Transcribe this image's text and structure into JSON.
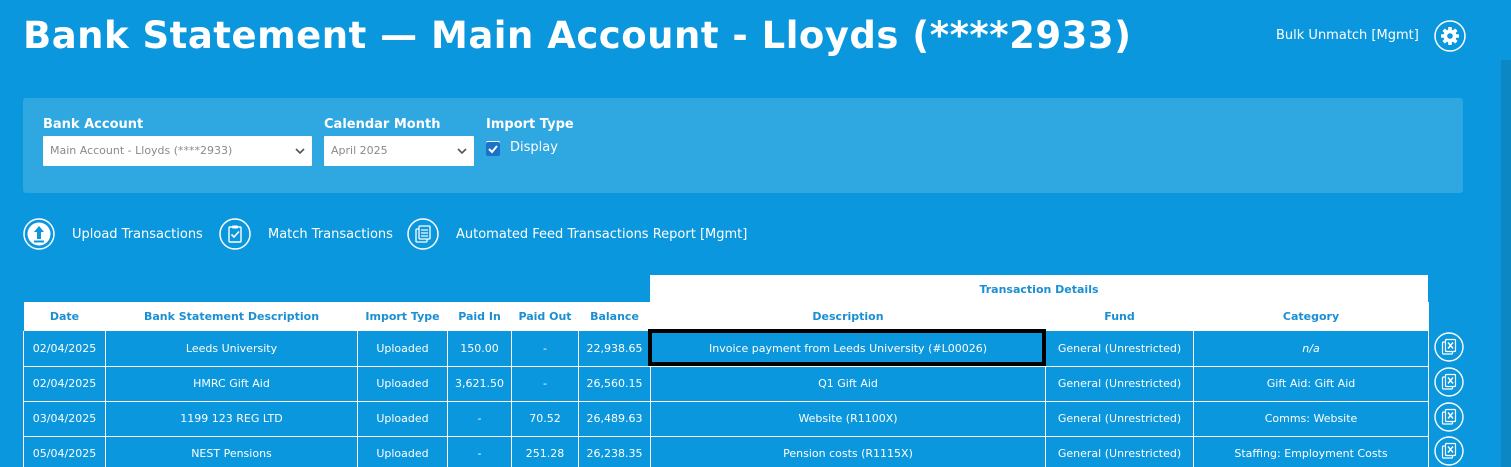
{
  "header": {
    "title": "Bank Statement — Main Account - Lloyds (****2933)",
    "bulk_unmatch_label": "Bulk Unmatch [Mgmt]",
    "settings_icon": "gear-icon"
  },
  "filters": {
    "bank_account": {
      "label": "Bank Account",
      "value": "Main Account - Lloyds (****2933)"
    },
    "calendar_month": {
      "label": "Calendar Month",
      "value": "April 2025"
    },
    "import_type": {
      "label": "Import Type",
      "option_label": "Display",
      "checked": true
    }
  },
  "actions": [
    {
      "label": "Upload Transactions",
      "icon": "upload-icon"
    },
    {
      "label": "Match Transactions",
      "icon": "match-icon"
    },
    {
      "label": "Automated Feed Transactions Report [Mgmt]",
      "icon": "report-icon"
    }
  ],
  "table": {
    "group_header": "Transaction Details",
    "columns": [
      "Date",
      "Bank Statement Description",
      "Import Type",
      "Paid In",
      "Paid Out",
      "Balance",
      "Description",
      "Fund",
      "Category"
    ],
    "rows": [
      [
        "02/04/2025",
        "Leeds University",
        "Uploaded",
        "150.00",
        "-",
        "22,938.65",
        "Invoice payment from Leeds University (#L00026)",
        "General (Unrestricted)",
        "n/a"
      ],
      [
        "02/04/2025",
        "HMRC Gift Aid",
        "Uploaded",
        "3,621.50",
        "-",
        "26,560.15",
        "Q1 Gift Aid",
        "General (Unrestricted)",
        "Gift Aid: Gift Aid"
      ],
      [
        "03/04/2025",
        "1199 123 REG LTD",
        "Uploaded",
        "-",
        "70.52",
        "26,489.63",
        "Website (R1100X)",
        "General (Unrestricted)",
        "Comms: Website"
      ],
      [
        "05/04/2025",
        "NEST Pensions",
        "Uploaded",
        "-",
        "251.28",
        "26,238.35",
        "Pension costs (R1115X)",
        "General (Unrestricted)",
        "Staffing: Employment Costs"
      ]
    ],
    "row_action_icon": "unmatch-icon"
  },
  "colors": {
    "background": "#0a97dd",
    "panel": "#2fa7e0",
    "header_text": "#1a8fd3"
  }
}
